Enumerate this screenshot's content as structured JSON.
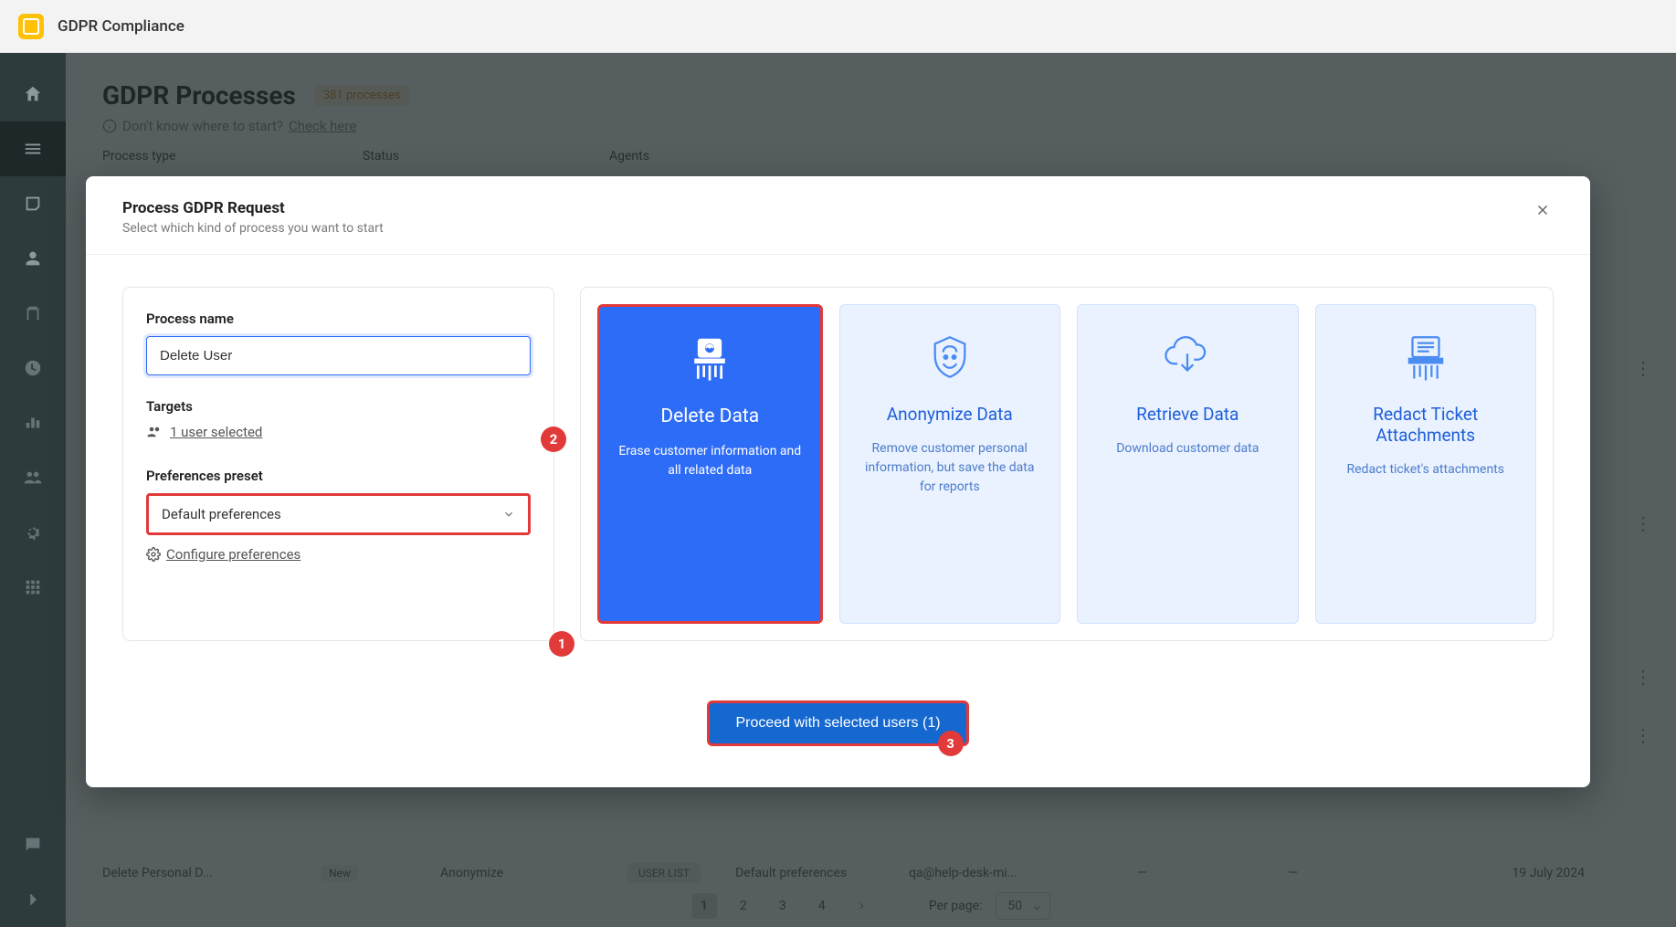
{
  "header": {
    "title": "GDPR Compliance"
  },
  "page": {
    "title": "GDPR Processes",
    "process_count": "381 processes",
    "help_prefix": "Don't know where to start?",
    "help_link": "Check here"
  },
  "table": {
    "headers": {
      "process_type": "Process type",
      "status": "Status",
      "agents": "Agents"
    },
    "row": {
      "name": "Delete Personal D...",
      "status": "New",
      "agent": "Anonymize",
      "user_list_label": "USER LIST",
      "prefs": "Default preferences",
      "email": "qa@help-desk-mi...",
      "dash": "—",
      "date": "19 July 2024"
    }
  },
  "pagination": {
    "pages": [
      "1",
      "2",
      "3",
      "4"
    ],
    "per_page_label": "Per page:",
    "per_page_value": "50"
  },
  "modal": {
    "title": "Process GDPR Request",
    "subtitle": "Select which kind of process you want to start",
    "process_name_label": "Process name",
    "process_name_value": "Delete User",
    "targets_label": "Targets",
    "targets_link": "1 user selected",
    "prefs_label": "Preferences preset",
    "prefs_value": "Default preferences",
    "config_link": "Configure preferences",
    "options": {
      "delete": {
        "title": "Delete Data",
        "desc": "Erase customer information and all related data"
      },
      "anonymize": {
        "title": "Anonymize Data",
        "desc": "Remove customer personal information, but save the data for reports"
      },
      "retrieve": {
        "title": "Retrieve Data",
        "desc": "Download customer data"
      },
      "redact": {
        "title": "Redact Ticket Attachments",
        "desc": "Redact ticket's attachments"
      }
    },
    "proceed_label": "Proceed with selected users (1)"
  },
  "badges": {
    "one": "1",
    "two": "2",
    "three": "3"
  }
}
